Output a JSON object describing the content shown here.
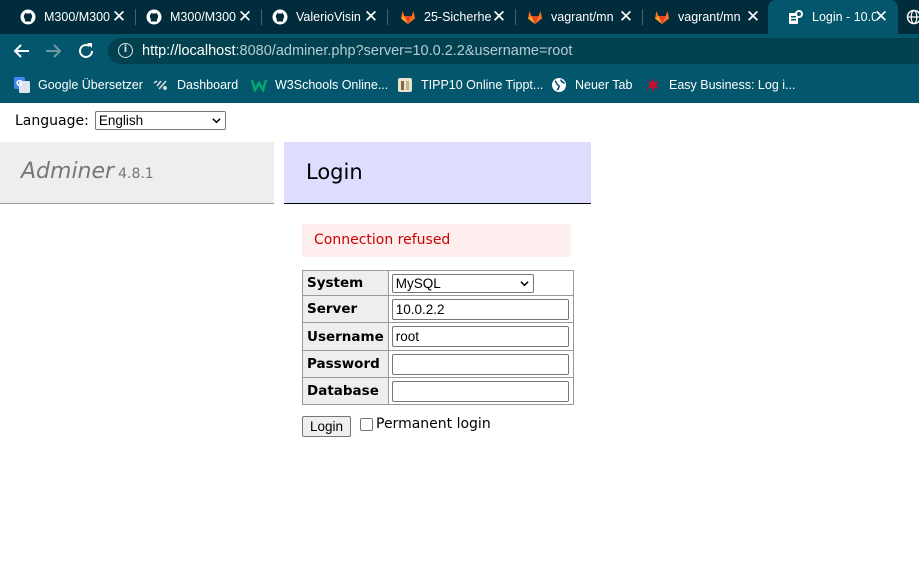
{
  "browser": {
    "tabs": [
      {
        "title": "M300/M300",
        "icon": "github-icon"
      },
      {
        "title": "M300/M300",
        "icon": "github-icon"
      },
      {
        "title": "ValerioVisin",
        "icon": "github-icon"
      },
      {
        "title": "25-Sicherhe",
        "icon": "gitlab-icon"
      },
      {
        "title": "vagrant/mn",
        "icon": "gitlab-icon"
      },
      {
        "title": "vagrant/mn",
        "icon": "gitlab-icon"
      },
      {
        "title": "Login - 10.0",
        "icon": "adminer-favicon-icon",
        "active": true
      }
    ],
    "tab_close_glyph": "✕",
    "url_host": "http://localhost",
    "url_rest": ":8080/adminer.php?server=10.0.2.2&username=root",
    "bookmarks": [
      {
        "label": "Google Übersetzer",
        "icon": "google-translate-icon"
      },
      {
        "label": "Dashboard",
        "icon": "dashboard-icon"
      },
      {
        "label": "W3Schools Online...",
        "icon": "w3schools-icon"
      },
      {
        "label": "TIPP10 Online Tippt...",
        "icon": "tipp10-icon"
      },
      {
        "label": "Neuer Tab",
        "icon": "globe-icon"
      },
      {
        "label": "Easy Business: Log i...",
        "icon": "easy-business-icon"
      }
    ]
  },
  "page": {
    "language_label": "Language:",
    "language_value": "English",
    "brand": "Adminer",
    "version": "4.8.1",
    "heading": "Login",
    "error": "Connection refused",
    "form": {
      "system_label": "System",
      "system_value": "MySQL",
      "server_label": "Server",
      "server_value": "10.0.2.2",
      "username_label": "Username",
      "username_value": "root",
      "password_label": "Password",
      "password_value": "",
      "database_label": "Database",
      "database_value": ""
    },
    "login_button": "Login",
    "permanent_login": "Permanent login"
  }
}
